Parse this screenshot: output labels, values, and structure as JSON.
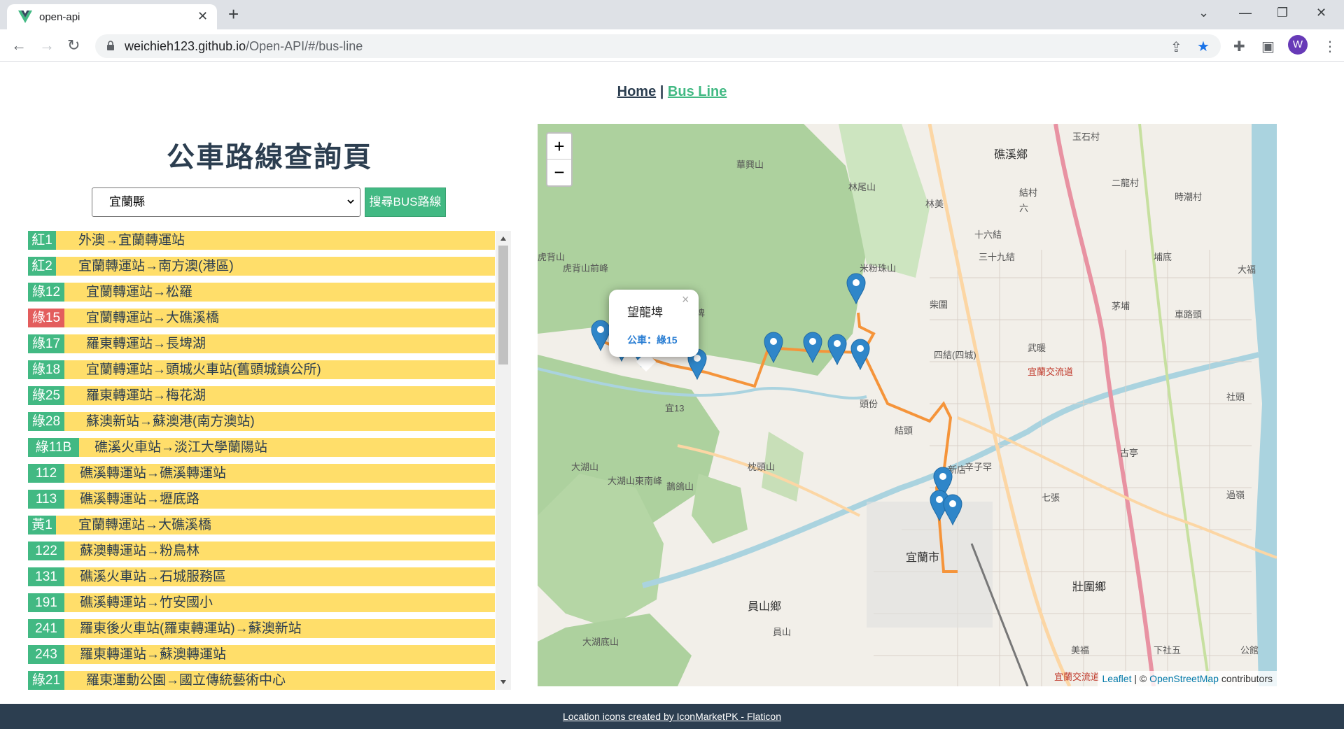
{
  "browser": {
    "tab_title": "open-api",
    "url_host": "weichieh123.github.io",
    "url_path": "/Open-API/#/bus-line",
    "profile_initial": "W"
  },
  "nav": {
    "home": "Home",
    "separator": " | ",
    "bus_line": "Bus Line"
  },
  "page": {
    "title": "公車路線查詢頁",
    "selected_city": "宜蘭縣",
    "search_button": "搜尋BUS路線"
  },
  "routes": [
    {
      "num": "紅1",
      "name": "外澳→宜蘭轉運站",
      "color": "#42b983"
    },
    {
      "num": "紅2",
      "name": "宜蘭轉運站→南方澳(港區)",
      "color": "#42b983"
    },
    {
      "num": "綠12",
      "name": "宜蘭轉運站→松羅",
      "color": "#42b983"
    },
    {
      "num": "綠15",
      "name": "宜蘭轉運站→大礁溪橋",
      "color": "#e35d5d"
    },
    {
      "num": "綠17",
      "name": "羅東轉運站→長埤湖",
      "color": "#42b983"
    },
    {
      "num": "綠18",
      "name": "宜蘭轉運站→頭城火車站(舊頭城鎮公所)",
      "color": "#42b983"
    },
    {
      "num": "綠25",
      "name": "羅東轉運站→梅花湖",
      "color": "#42b983"
    },
    {
      "num": "綠28",
      "name": "蘇澳新站→蘇澳港(南方澳站)",
      "color": "#42b983"
    },
    {
      "num": "綠11B",
      "name": "礁溪火車站→淡江大學蘭陽站",
      "color": "#42b983"
    },
    {
      "num": "112",
      "name": "礁溪轉運站→礁溪轉運站",
      "color": "#42b983"
    },
    {
      "num": "113",
      "name": "礁溪轉運站→壢底路",
      "color": "#42b983"
    },
    {
      "num": "黃1",
      "name": "宜蘭轉運站→大礁溪橋",
      "color": "#42b983"
    },
    {
      "num": "122",
      "name": "蘇澳轉運站→粉鳥林",
      "color": "#42b983"
    },
    {
      "num": "131",
      "name": "礁溪火車站→石城服務區",
      "color": "#42b983"
    },
    {
      "num": "191",
      "name": "礁溪轉運站→竹安國小",
      "color": "#42b983"
    },
    {
      "num": "241",
      "name": "羅東後火車站(羅東轉運站)→蘇澳新站",
      "color": "#42b983"
    },
    {
      "num": "243",
      "name": "羅東轉運站→蘇澳轉運站",
      "color": "#42b983"
    },
    {
      "num": "綠21",
      "name": "羅東運動公園→國立傳統藝術中心",
      "color": "#42b983"
    }
  ],
  "map": {
    "zoom_in": "+",
    "zoom_out": "−",
    "popup_stop": "望龍埤",
    "popup_route": "公車：綠15",
    "popup_close": "×",
    "attribution_leaflet": "Leaflet",
    "attribution_sep": " | © ",
    "attribution_osm": "OpenStreetMap",
    "attribution_tail": " contributors",
    "labels": [
      "礁溪鄉",
      "林美",
      "十六結",
      "三十九結",
      "柴圍",
      "四結(四城)",
      "武暖",
      "新店",
      "辛子罕",
      "古亭",
      "宜蘭市",
      "員山鄉",
      "壯圍鄉",
      "美福",
      "下社五",
      "公館",
      "過嶺",
      "社頭",
      "茅埔",
      "車路頭",
      "大福",
      "埔底",
      "二龍村",
      "時潮村",
      "結頭",
      "七張",
      "頭份",
      "玉石村",
      "結村",
      "六",
      "大湖山",
      "大湖山東南峰",
      "鵲鴿山",
      "枕頭山",
      "員山",
      "大湖底山",
      "虎背山",
      "虎背山前峰",
      "望龍埤",
      "米粉珠山",
      "林尾山",
      "華興山",
      "宜蘭交流道",
      "宜蘭交流道"
    ],
    "route_label": "宜13"
  },
  "footer": "Location icons created by IconMarketPK - Flaticon"
}
